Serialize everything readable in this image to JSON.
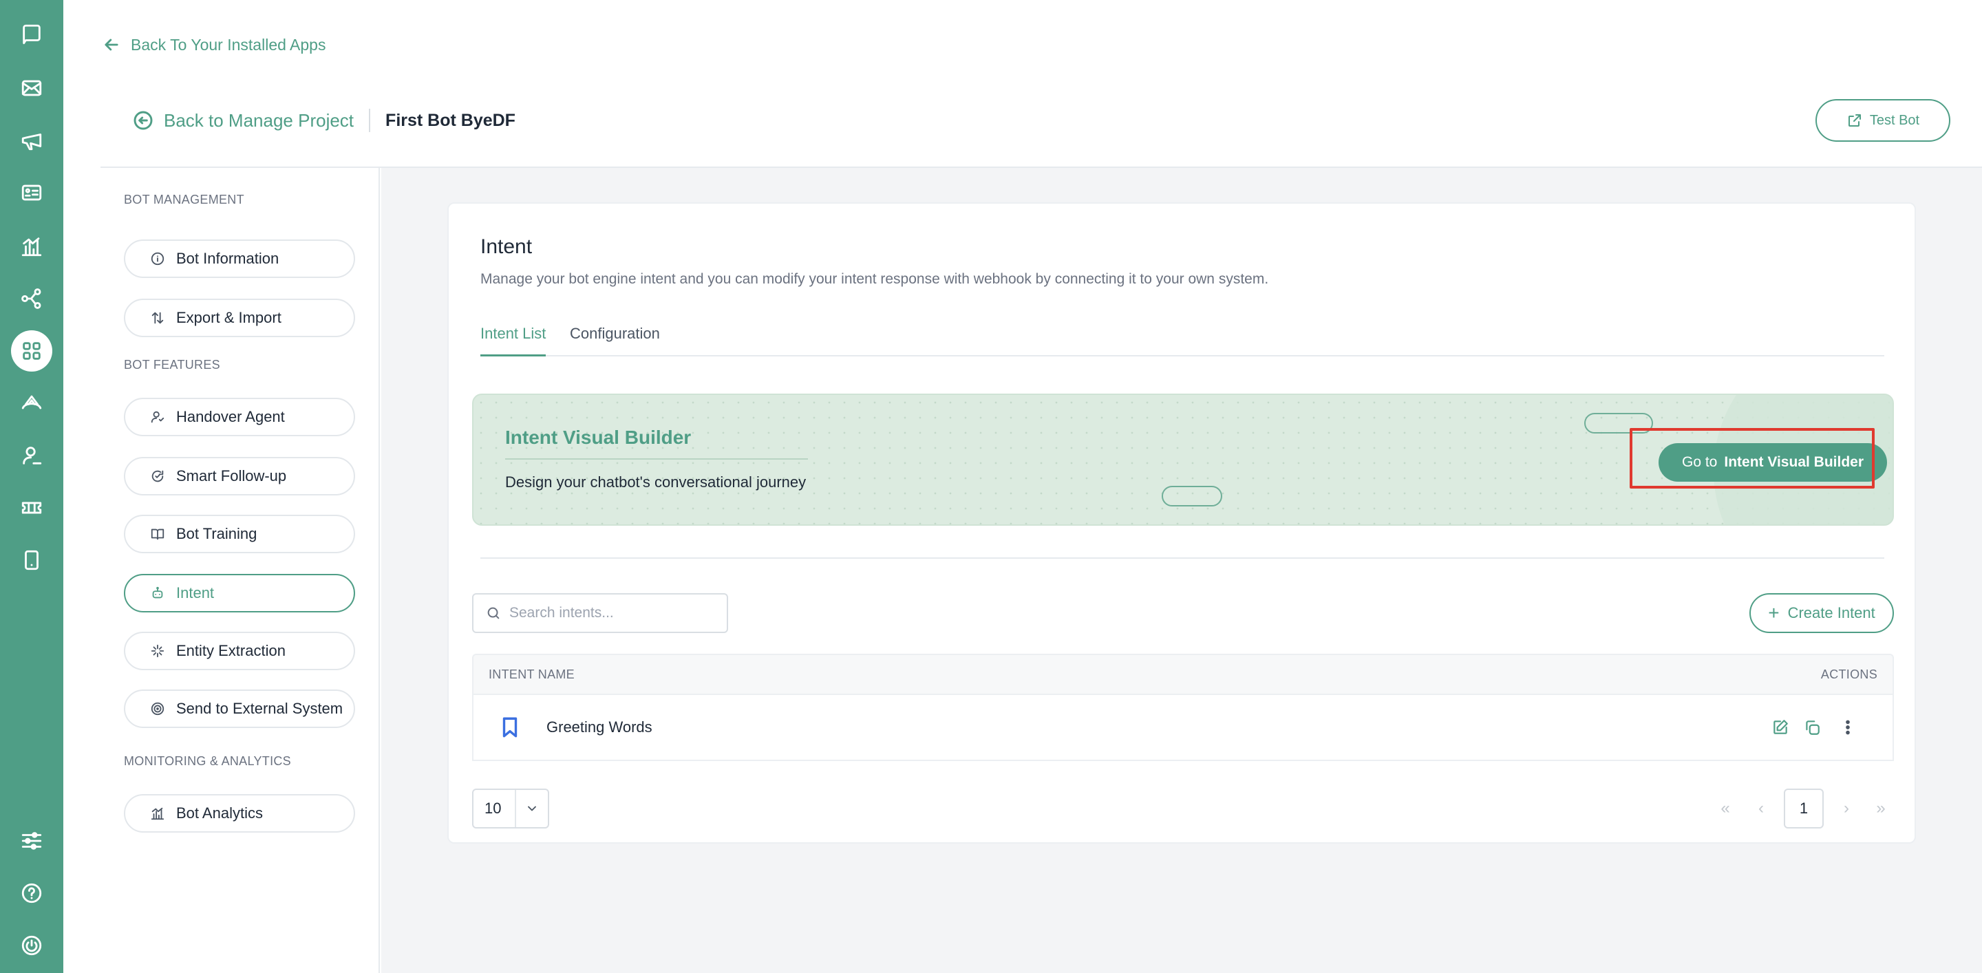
{
  "nav": {
    "back_to_apps": "Back To Your Installed Apps",
    "back_to_project": "Back to Manage Project",
    "bot_name": "First Bot ByeDF",
    "test_bot": "Test Bot"
  },
  "rail_icons": [
    "chat-icon",
    "mail-icon",
    "megaphone-icon",
    "contact-card-icon",
    "analytics-icon",
    "integration-icon",
    "apps-grid-icon",
    "broadcast-icon",
    "agent-icon",
    "ticket-icon",
    "mobile-icon",
    "settings-sliders-icon",
    "help-icon",
    "power-icon"
  ],
  "sidebar": {
    "section_management": "BOT MANAGEMENT",
    "section_features": "BOT FEATURES",
    "section_monitoring": "MONITORING & ANALYTICS",
    "items": [
      {
        "label": "Bot Information",
        "icon": "info-icon"
      },
      {
        "label": "Export & Import",
        "icon": "export-import-icon"
      },
      {
        "label": "Handover Agent",
        "icon": "handover-icon"
      },
      {
        "label": "Smart Follow-up",
        "icon": "follow-up-icon"
      },
      {
        "label": "Bot Training",
        "icon": "book-icon"
      },
      {
        "label": "Intent",
        "icon": "intent-icon"
      },
      {
        "label": "Entity Extraction",
        "icon": "entity-icon"
      },
      {
        "label": "Send to External System",
        "icon": "target-icon"
      },
      {
        "label": "Bot Analytics",
        "icon": "analytics-icon"
      }
    ],
    "active": "Intent"
  },
  "intent": {
    "title": "Intent",
    "description": "Manage your bot engine intent and you can modify your intent response with webhook by connecting it to your own system.",
    "tabs": [
      "Intent List",
      "Configuration"
    ],
    "active_tab": "Intent List"
  },
  "banner": {
    "title": "Intent Visual Builder",
    "subtitle": "Design your chatbot's conversational journey",
    "button_prefix": "Go to",
    "button_label": "Intent Visual Builder"
  },
  "search": {
    "placeholder": "Search intents..."
  },
  "create_intent": "Create Intent",
  "table": {
    "columns": [
      "INTENT NAME",
      "ACTIONS"
    ],
    "rows": [
      {
        "name": "Greeting Words"
      }
    ]
  },
  "pagination": {
    "page_size": "10",
    "current_page": "1",
    "first": "«",
    "prev": "‹",
    "next": "›",
    "last": "»"
  },
  "colors": {
    "primary": "#4f9e86",
    "highlight": "#e03a2f",
    "bookmark": "#3b6fe0"
  }
}
